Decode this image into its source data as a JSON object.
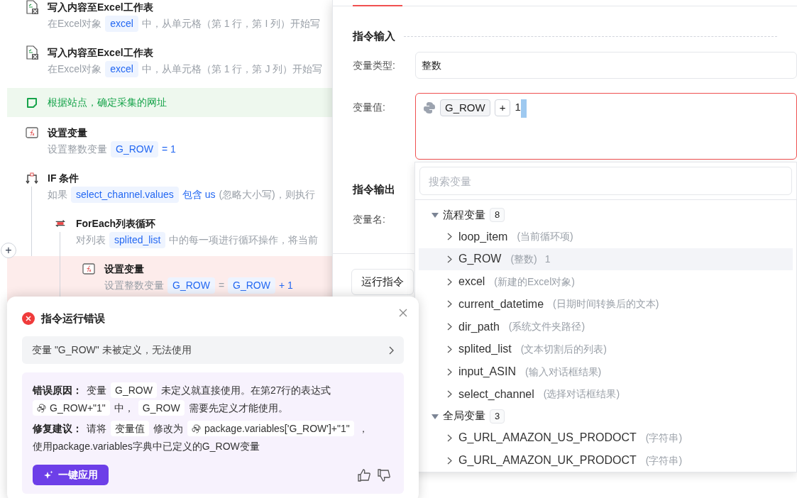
{
  "flow": [
    {
      "kind": "excel",
      "title": "写入内容至Excel工作表",
      "error": false,
      "desc": [
        {
          "kind": "text",
          "text": "在Excel对象"
        },
        {
          "kind": "var",
          "text": "excel"
        },
        {
          "kind": "text",
          "text": "中，从单元格（第 1 行，第 I 列）开始写"
        }
      ]
    },
    {
      "kind": "excel",
      "title": "写入内容至Excel工作表",
      "error": false,
      "desc": [
        {
          "kind": "text",
          "text": "在Excel对象"
        },
        {
          "kind": "var",
          "text": "excel"
        },
        {
          "kind": "text",
          "text": "中，从单元格（第 1 行，第 J 列）开始写"
        }
      ]
    },
    {
      "kind": "note",
      "title": "根据站点，确定采集的网址",
      "error": false
    },
    {
      "kind": "setvar",
      "title": "设置变量",
      "error": false,
      "desc": [
        {
          "kind": "text",
          "text": "设置整数变量"
        },
        {
          "kind": "var",
          "text": "G_ROW"
        },
        {
          "kind": "value",
          "text": "= 1"
        }
      ]
    },
    {
      "kind": "if",
      "title": "IF 条件",
      "error": false,
      "desc": [
        {
          "kind": "text",
          "text": "如果"
        },
        {
          "kind": "var",
          "text": "select_channel.values"
        },
        {
          "kind": "value",
          "text": "包含 us"
        },
        {
          "kind": "text",
          "text": "(忽略大小写)，则执行"
        }
      ],
      "children": [
        {
          "kind": "loop",
          "title": "ForEach列表循环",
          "error": false,
          "desc": [
            {
              "kind": "text",
              "text": "对列表"
            },
            {
              "kind": "var",
              "text": "splited_list"
            },
            {
              "kind": "text",
              "text": "中的每一项进行循环操作，将当前"
            }
          ],
          "children": [
            {
              "kind": "setvar",
              "title": "设置变量",
              "error": true,
              "desc": [
                {
                  "kind": "text",
                  "text": "设置整数变量"
                },
                {
                  "kind": "var",
                  "text": "G_ROW"
                },
                {
                  "kind": "text",
                  "text": "="
                },
                {
                  "kind": "var",
                  "text": "G_ROW"
                },
                {
                  "kind": "value",
                  "text": "+ 1"
                }
              ]
            }
          ]
        }
      ]
    }
  ],
  "add_button": "+",
  "dialog": {
    "input_section": "指令输入",
    "fields": [
      {
        "label": "变量类型:",
        "value": "整数"
      }
    ],
    "value_field": {
      "label": "变量值:",
      "error": true,
      "tokens": [
        {
          "kind": "chip",
          "text": "G_ROW"
        },
        {
          "kind": "chip",
          "text": "+"
        },
        {
          "kind": "text",
          "text": "1"
        }
      ]
    },
    "output_section": "指令输出",
    "output_label": "变量名:",
    "run_button": "运行指令"
  },
  "dropdown": {
    "search": {
      "placeholder": "搜索变量"
    },
    "groups": [
      {
        "label": "流程变量",
        "count": "8",
        "expanded": true,
        "children": [
          {
            "name": "loop_item",
            "type": "(当前循环项)",
            "selected": false
          },
          {
            "name": "G_ROW",
            "type": "(整数)",
            "value": "1",
            "selected": true
          },
          {
            "name": "excel",
            "type": "(新建的Excel对象)",
            "selected": false
          },
          {
            "name": "current_datetime",
            "type": "(日期时间转换后的文本)",
            "selected": false
          },
          {
            "name": "dir_path",
            "type": "(系统文件夹路径)",
            "selected": false
          },
          {
            "name": "splited_list",
            "type": "(文本切割后的列表)",
            "selected": false
          },
          {
            "name": "input_ASIN",
            "type": "(输入对话框结果)",
            "selected": false
          },
          {
            "name": "select_channel",
            "type": "(选择对话框结果)",
            "selected": false
          }
        ]
      },
      {
        "label": "全局变量",
        "count": "3",
        "expanded": true,
        "children": [
          {
            "name": "G_URL_AMAZON_US_PRODOCT",
            "type": "(字符串)",
            "selected": false
          },
          {
            "name": "G_URL_AMAZON_UK_PRODOCT",
            "type": "(字符串)",
            "selected": false
          }
        ]
      }
    ]
  },
  "error_popup": {
    "title": "指令运行错误",
    "message": "变量 \"G_ROW\" 未被定义，无法使用",
    "reason": [
      {
        "kind": "label",
        "text": "错误原因："
      },
      {
        "kind": "text",
        "text": "变量"
      },
      {
        "kind": "code",
        "text": "G_ROW"
      },
      {
        "kind": "text",
        "text": "未定义就直接使用。在第27行的表达式"
      },
      {
        "kind": "expr",
        "text": "G_ROW+\"1\""
      },
      {
        "kind": "text",
        "text": "中，"
      },
      {
        "kind": "code",
        "text": "G_ROW"
      },
      {
        "kind": "text",
        "text": "需要先定义才能使用。"
      }
    ],
    "fix": [
      {
        "kind": "label",
        "text": "修复建议："
      },
      {
        "kind": "text",
        "text": "请将"
      },
      {
        "kind": "code",
        "text": "变量值"
      },
      {
        "kind": "text",
        "text": "修改为"
      },
      {
        "kind": "expr",
        "text": "package.variables['G_ROW']+\"1\""
      },
      {
        "kind": "text",
        "text": "，"
      },
      {
        "kind": "text",
        "text": "使用package.variables字典中已定义的G_ROW变量"
      }
    ],
    "apply_button": "一键应用"
  }
}
